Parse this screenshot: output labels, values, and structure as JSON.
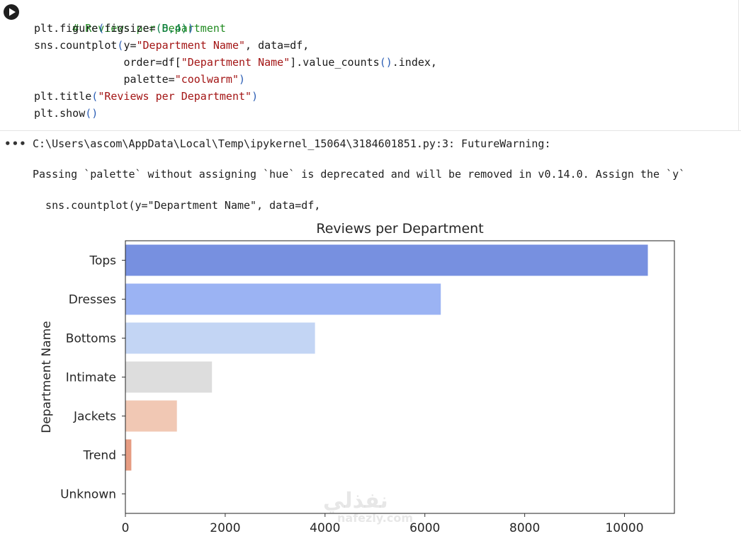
{
  "code": {
    "comment": "# Reviews per Department",
    "line2_fn": "plt.figure",
    "line2_args_a": "figsize=",
    "line2_num": "(8,4)",
    "line3_fn": "sns.countplot",
    "line3_a": "y=",
    "line3_str": "\"Department Name\"",
    "line3_b": ", data=df,",
    "line4_a": "order=df[",
    "line4_str": "\"Department Name\"",
    "line4_b": "].value_counts",
    "line4_c": ".index,",
    "line5_a": "palette=",
    "line5_str": "\"coolwarm\"",
    "line6_fn": "plt.title",
    "line6_str": "\"Reviews per Department\"",
    "line7_fn": "plt.show"
  },
  "output": {
    "menu": "•••",
    "warning_path": "C:\\Users\\ascom\\AppData\\Local\\Temp\\ipykernel_15064\\3184601851.py:3: FutureWarning:",
    "warning_msg": "Passing `palette` without assigning `hue` is deprecated and will be removed in v0.14.0. Assign the `y`",
    "warning_src": "  sns.countplot(y=\"Department Name\", data=df,"
  },
  "watermark": {
    "big": "نفذلي",
    "small": "nafezly.com"
  },
  "chart_data": {
    "type": "bar",
    "orientation": "horizontal",
    "title": "Reviews per Department",
    "xlabel": "",
    "ylabel": "Department Name",
    "categories": [
      "Tops",
      "Dresses",
      "Bottoms",
      "Intimate",
      "Jackets",
      "Trend",
      "Unknown"
    ],
    "values": [
      10468,
      6319,
      3799,
      1735,
      1032,
      119,
      0
    ],
    "colors": [
      "#7790e0",
      "#9bb3f3",
      "#c3d5f4",
      "#dddddd",
      "#f1c8b4",
      "#e69c82",
      "#c5573f"
    ],
    "xlim": [
      0,
      11000
    ],
    "xticks": [
      0,
      2000,
      4000,
      6000,
      8000,
      10000
    ],
    "grid": false
  }
}
